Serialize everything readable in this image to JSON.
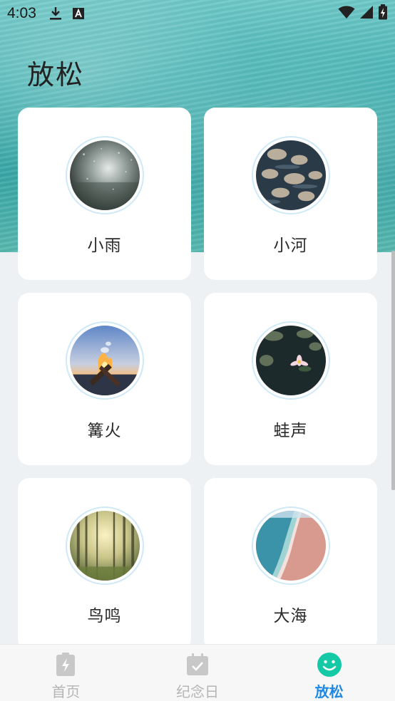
{
  "status_bar": {
    "time": "4:03",
    "icons": [
      "download-icon",
      "a-box-icon",
      "wifi-icon",
      "signal-icon",
      "battery-icon"
    ]
  },
  "header": {
    "title": "放松"
  },
  "sounds": [
    {
      "label": "小雨",
      "image": "rain-window-photo"
    },
    {
      "label": "小河",
      "image": "river-stones-photo"
    },
    {
      "label": "篝火",
      "image": "campfire-photo"
    },
    {
      "label": "蛙声",
      "image": "lotus-pond-photo"
    },
    {
      "label": "鸟鸣",
      "image": "forest-photo"
    },
    {
      "label": "大海",
      "image": "beach-aerial-photo"
    }
  ],
  "tabs": [
    {
      "label": "首页",
      "icon": "battery-bolt-icon",
      "active": false
    },
    {
      "label": "纪念日",
      "icon": "calendar-check-icon",
      "active": false
    },
    {
      "label": "放松",
      "icon": "smile-icon",
      "active": true
    }
  ],
  "colors": {
    "accent": "#1e88e5",
    "smile_icon": "#14c9a6",
    "ring": "#cfe9f7"
  }
}
